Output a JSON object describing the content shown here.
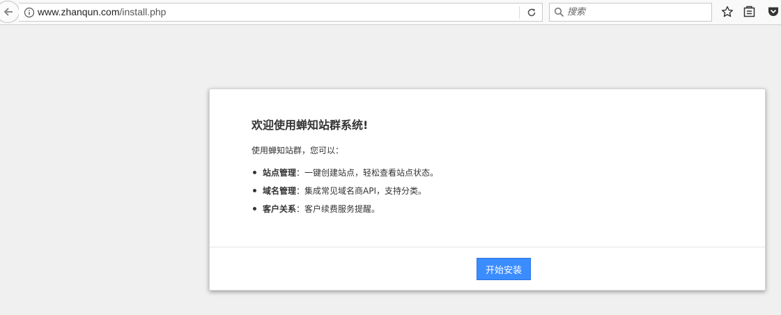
{
  "browser": {
    "url_host": "www.zhanqun.com",
    "url_path": "/install.php",
    "search_placeholder": "搜索",
    "icons": {
      "back": "back-arrow-icon",
      "info": "info-icon",
      "reload": "reload-icon",
      "search": "search-icon",
      "bookmark": "star-icon",
      "reading_list": "reading-list-icon",
      "pocket": "pocket-icon"
    }
  },
  "dialog": {
    "title": "欢迎使用蝉知站群系统!",
    "intro": "使用蝉知站群，您可以：",
    "features": [
      {
        "name": "站点管理",
        "desc": "：一键创建站点，轻松查看站点状态。"
      },
      {
        "name": "域名管理",
        "desc": "：集成常见域名商API，支持分类。"
      },
      {
        "name": "客户关系",
        "desc": "：客户续费服务提醒。"
      }
    ],
    "install_label": "开始安装"
  },
  "colors": {
    "page_background": "#f0f0f0",
    "primary_button": "#3b8cff",
    "text": "#333333"
  }
}
